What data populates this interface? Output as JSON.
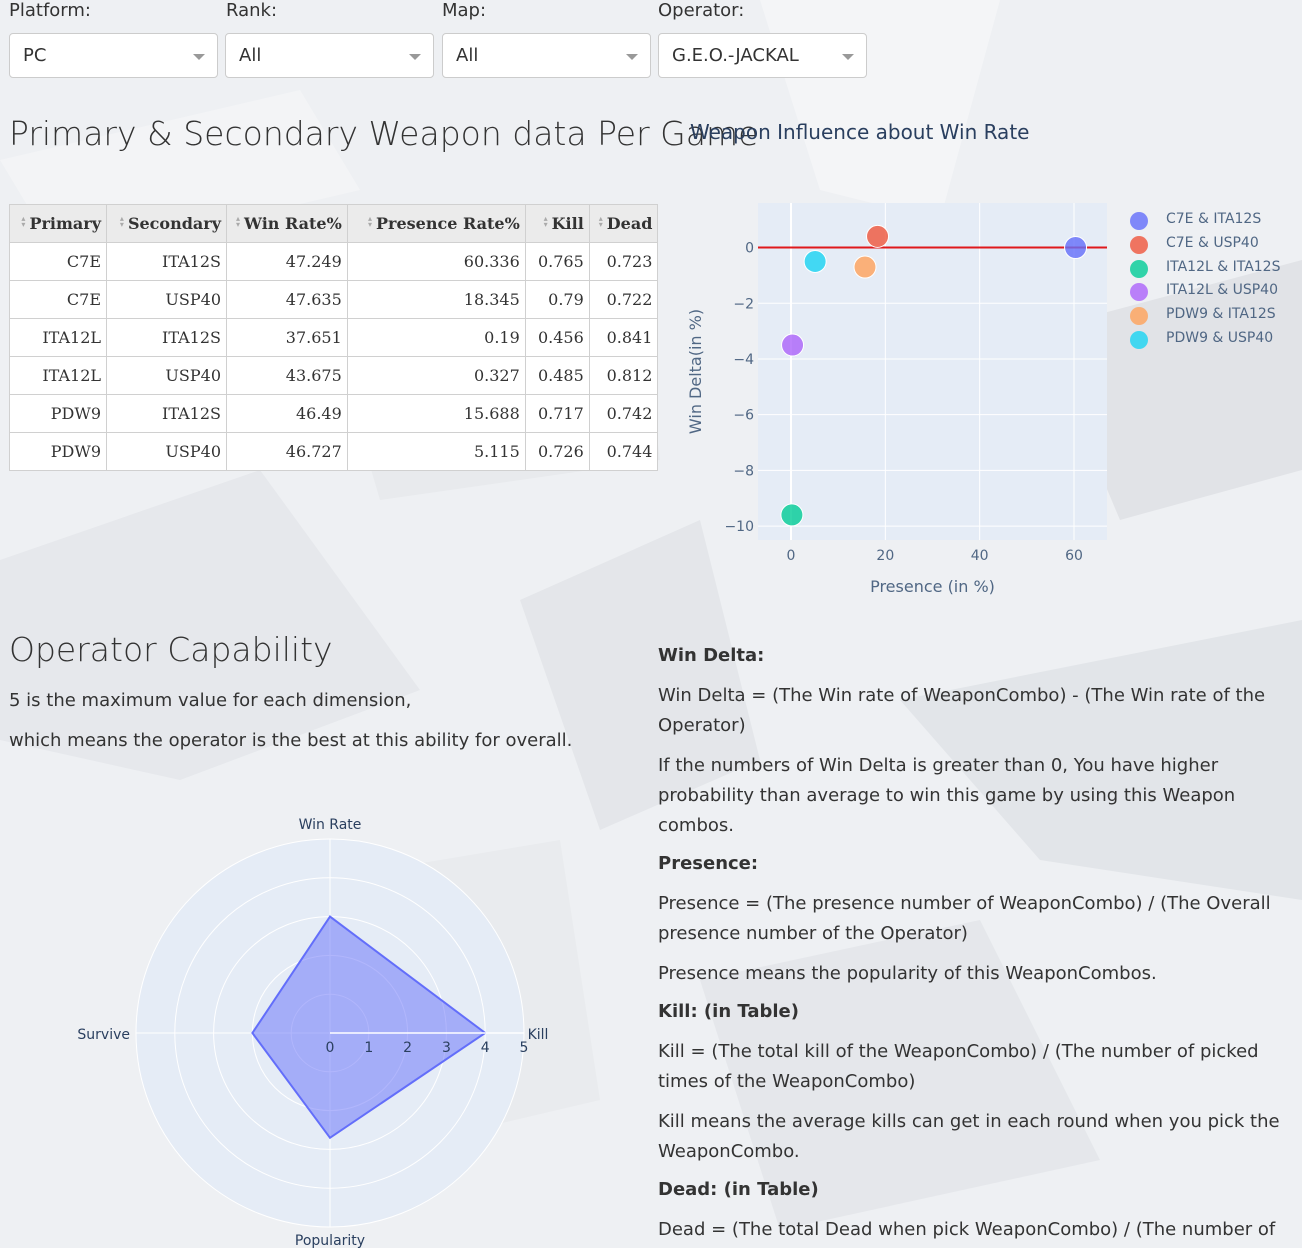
{
  "filters": [
    {
      "label": "Platform:",
      "value": "PC"
    },
    {
      "label": "Rank:",
      "value": "All"
    },
    {
      "label": "Map:",
      "value": "All"
    },
    {
      "label": "Operator:",
      "value": "G.E.O.-JACKAL"
    }
  ],
  "weapon_section": {
    "title": "Primary & Secondary Weapon data Per Game",
    "table": {
      "columns": [
        "Primary",
        "Secondary",
        "Win Rate%",
        "Presence Rate%",
        "Kill",
        "Dead"
      ],
      "rows": [
        [
          "C7E",
          "ITA12S",
          "47.249",
          "60.336",
          "0.765",
          "0.723"
        ],
        [
          "C7E",
          "USP40",
          "47.635",
          "18.345",
          "0.79",
          "0.722"
        ],
        [
          "ITA12L",
          "ITA12S",
          "37.651",
          "0.19",
          "0.456",
          "0.841"
        ],
        [
          "ITA12L",
          "USP40",
          "43.675",
          "0.327",
          "0.485",
          "0.812"
        ],
        [
          "PDW9",
          "ITA12S",
          "46.49",
          "15.688",
          "0.717",
          "0.742"
        ],
        [
          "PDW9",
          "USP40",
          "46.727",
          "5.115",
          "0.726",
          "0.744"
        ]
      ]
    }
  },
  "scatter_section": {
    "title": "Weapon Influence about Win Rate"
  },
  "capability_section": {
    "title": "Operator Capability",
    "line1": "5 is the maximum value for each dimension,",
    "line2": "which means the operator is the best at this ability for overall."
  },
  "description": {
    "win_delta_heading": "Win Delta:",
    "win_delta_formula": "Win Delta = (The Win rate of WeaponCombo) - (The Win rate of the Operator)",
    "win_delta_note": "If the numbers of Win Delta is greater than 0, You have higher probability than average to win this game by using this Weapon combos.",
    "presence_heading": "Presence:",
    "presence_formula": "Presence = (The presence number of WeaponCombo) / (The Overall presence number of the Operator)",
    "presence_note": "Presence means the popularity of this WeaponCombos.",
    "kill_heading": "Kill: (in Table)",
    "kill_formula": "Kill = (The total kill of the WeaponCombo) / (The number of picked times of the WeaponCombo)",
    "kill_note": "Kill means the average kills can get in each round when you pick the WeaponCombo.",
    "dead_heading": "Dead: (in Table)",
    "dead_formula": "Dead = (The total Dead when pick WeaponCombo) / (The number of picked times of the WeaponCombo)"
  },
  "colors": {
    "zero_line": "#e0191c",
    "plot_bg": "#e5ecf6",
    "radar_fill": "#636efa"
  },
  "chart_data": [
    {
      "type": "scatter",
      "title": "Weapon Influence about Win Rate",
      "xlabel": "Presence (in %)",
      "ylabel": "Win Delta(in %)",
      "xlim": [
        -7,
        67
      ],
      "ylim": [
        -10.5,
        1.6
      ],
      "x_ticks": [
        0,
        20,
        40,
        60
      ],
      "y_ticks": [
        0,
        -2,
        -4,
        -6,
        -8,
        -10
      ],
      "y_tick_labels": [
        "0",
        "−2",
        "−4",
        "−6",
        "−8",
        "−10"
      ],
      "reference_line_y": 0,
      "legend_position": "right",
      "series": [
        {
          "name": "C7E & ITA12S",
          "color": "#636efa",
          "x": [
            60.336
          ],
          "y": [
            0.0
          ]
        },
        {
          "name": "C7E & USP40",
          "color": "#ef553b",
          "x": [
            18.345
          ],
          "y": [
            0.4
          ]
        },
        {
          "name": "ITA12L & ITA12S",
          "color": "#00cc96",
          "x": [
            0.19
          ],
          "y": [
            -9.6
          ]
        },
        {
          "name": "ITA12L & USP40",
          "color": "#ab63fa",
          "x": [
            0.327
          ],
          "y": [
            -3.5
          ]
        },
        {
          "name": "PDW9 & ITA12S",
          "color": "#ffa15a",
          "x": [
            15.688
          ],
          "y": [
            -0.7
          ]
        },
        {
          "name": "PDW9 & USP40",
          "color": "#19d3f3",
          "x": [
            5.115
          ],
          "y": [
            -0.5
          ]
        }
      ]
    },
    {
      "type": "radar",
      "axes": [
        "Win Rate",
        "Kill",
        "Popularity",
        "Survive"
      ],
      "values": [
        3.0,
        4.0,
        2.7,
        2.0
      ],
      "range": [
        0,
        5
      ],
      "radial_ticks": [
        "0",
        "1",
        "2",
        "3",
        "4",
        "5"
      ]
    }
  ]
}
